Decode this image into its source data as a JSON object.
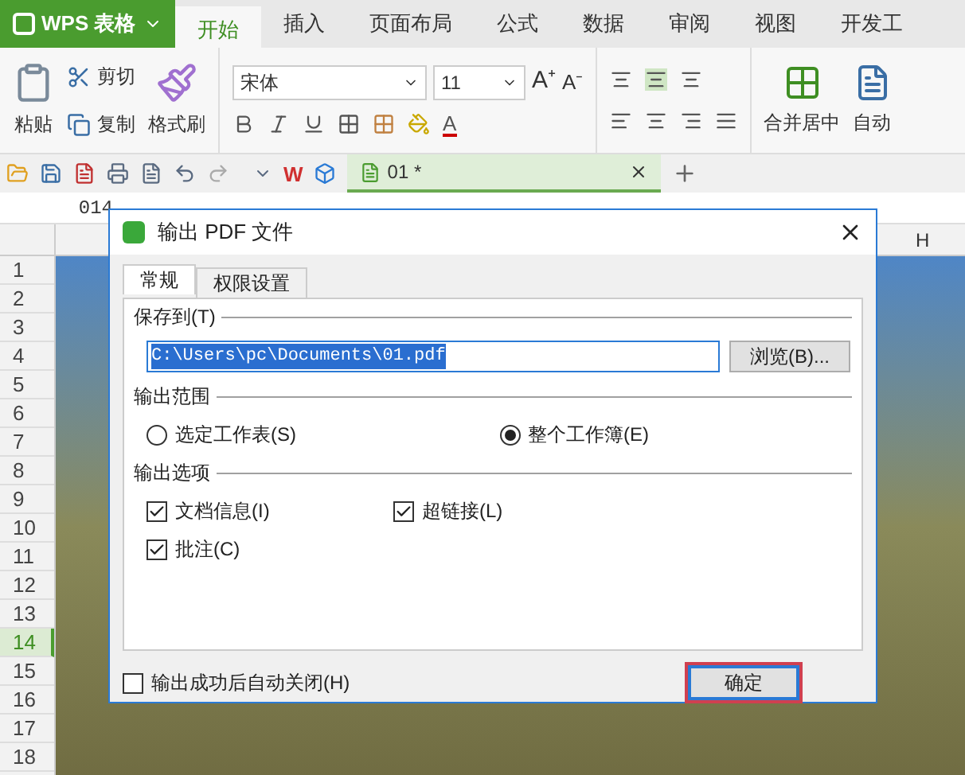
{
  "app": {
    "logo_text": "WPS 表格"
  },
  "menu_tabs": [
    {
      "label": "开始",
      "selected": true
    },
    {
      "label": "插入",
      "selected": false
    },
    {
      "label": "页面布局",
      "selected": false
    },
    {
      "label": "公式",
      "selected": false
    },
    {
      "label": "数据",
      "selected": false
    },
    {
      "label": "审阅",
      "selected": false
    },
    {
      "label": "视图",
      "selected": false
    },
    {
      "label": "开发工",
      "selected": false
    }
  ],
  "ribbon": {
    "paste": "粘贴",
    "cut": "剪切",
    "copy": "复制",
    "format_painter": "格式刷",
    "font_name": "宋体",
    "font_size": "11",
    "merge": "合并居中",
    "wrap": "自动",
    "grow_font": "A⁺",
    "shrink_font": "A⁻",
    "font_color": "A"
  },
  "wps_logo": "W",
  "doc_tab": {
    "title": "01 *"
  },
  "name_box": "014",
  "column_header": "H",
  "rows": [
    {
      "label": "1",
      "selected": false
    },
    {
      "label": "2",
      "selected": false
    },
    {
      "label": "3",
      "selected": false
    },
    {
      "label": "4",
      "selected": false
    },
    {
      "label": "5",
      "selected": false
    },
    {
      "label": "6",
      "selected": false
    },
    {
      "label": "7",
      "selected": false
    },
    {
      "label": "8",
      "selected": false
    },
    {
      "label": "9",
      "selected": false
    },
    {
      "label": "10",
      "selected": false
    },
    {
      "label": "11",
      "selected": false
    },
    {
      "label": "12",
      "selected": false
    },
    {
      "label": "13",
      "selected": false
    },
    {
      "label": "14",
      "selected": true
    },
    {
      "label": "15",
      "selected": false
    },
    {
      "label": "16",
      "selected": false
    },
    {
      "label": "17",
      "selected": false
    },
    {
      "label": "18",
      "selected": false
    }
  ],
  "dialog": {
    "title": "输出 PDF 文件",
    "tabs": [
      {
        "label": "常规",
        "selected": true
      },
      {
        "label": "权限设置",
        "selected": false
      }
    ],
    "save_section": "保存到(T)",
    "path": "C:\\Users\\pc\\Documents\\01.pdf",
    "browse": "浏览(B)...",
    "range_section": "输出范围",
    "range_options": [
      {
        "label": "选定工作表(S)",
        "selected": false
      },
      {
        "label": "整个工作簿(E)",
        "selected": true
      }
    ],
    "options_section": "输出选项",
    "options": [
      {
        "label": "文档信息(I)",
        "checked": true
      },
      {
        "label": "超链接(L)",
        "checked": true
      },
      {
        "label": "批注(C)",
        "checked": true
      }
    ],
    "auto_close": {
      "label": "输出成功后自动关闭(H)",
      "checked": false
    },
    "confirm": "确定"
  }
}
